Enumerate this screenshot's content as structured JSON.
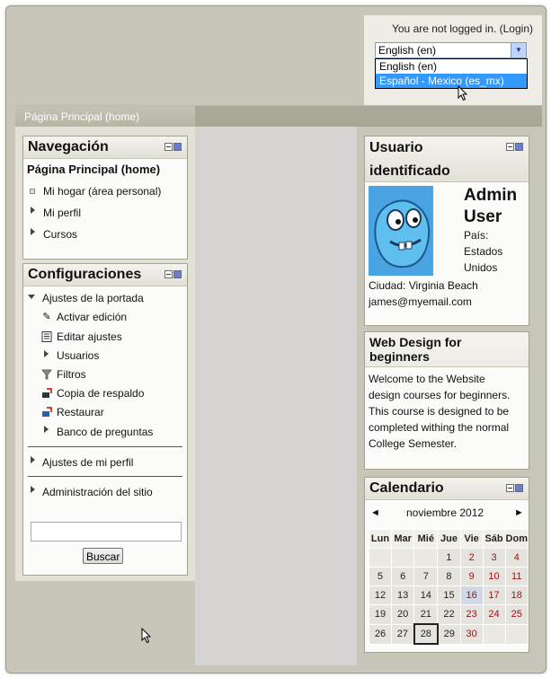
{
  "header": {
    "login_text": "You are not logged in. (Login)",
    "language_selected": "English (en)",
    "language_options": [
      "English (en)",
      "Español - Mexico (es_mx)"
    ]
  },
  "breadcrumb": {
    "home": "Página Principal (home)"
  },
  "navigation": {
    "title": "Navegación",
    "home": "Página Principal (home)",
    "items": [
      "Mi hogar (área personal)",
      "Mi perfil",
      "Cursos"
    ]
  },
  "settings": {
    "title": "Configuraciones",
    "section": "Ajustes de la portada",
    "items": [
      "Activar edición",
      "Editar ajustes",
      "Usuarios",
      "Filtros",
      "Copia de respaldo",
      "Restaurar",
      "Banco de preguntas"
    ],
    "profile": "Ajustes de mi perfil",
    "admin": "Administración del sitio",
    "search_button": "Buscar"
  },
  "user_block": {
    "title_line1": "Usuario",
    "title_line2": "identificado",
    "name_line1": "Admin",
    "name_line2": "User",
    "country_lines": [
      "País:",
      "Estados",
      "Unidos"
    ],
    "city": "Ciudad: Virginia Beach",
    "email": "james@myemail.com"
  },
  "course_block": {
    "title_line1": "Web Design for",
    "title_line2": "beginners",
    "body_lines": [
      "Welcome to the Website",
      "design courses for beginners.",
      "This course is designed to be",
      "completed withing the normal",
      "College Semester."
    ]
  },
  "calendar": {
    "title": "Calendario",
    "prev": "◄",
    "next": "►",
    "month": "noviembre 2012",
    "days": [
      "Lun",
      "Mar",
      "Mié",
      "Jue",
      "Vie",
      "Sáb",
      "Dom"
    ],
    "weeks": [
      [
        "",
        "",
        "",
        "1",
        "2",
        "3",
        "4"
      ],
      [
        "5",
        "6",
        "7",
        "8",
        "9",
        "10",
        "11"
      ],
      [
        "12",
        "13",
        "14",
        "15",
        "16",
        "17",
        "18"
      ],
      [
        "19",
        "20",
        "21",
        "22",
        "23",
        "24",
        "25"
      ],
      [
        "26",
        "27",
        "28",
        "29",
        "30",
        "",
        ""
      ]
    ],
    "today": "28",
    "event_day": "16"
  },
  "colors": {
    "frame": "#c8c6b9",
    "selected_option": "#3399ff",
    "weekend_text": "#a01010"
  }
}
